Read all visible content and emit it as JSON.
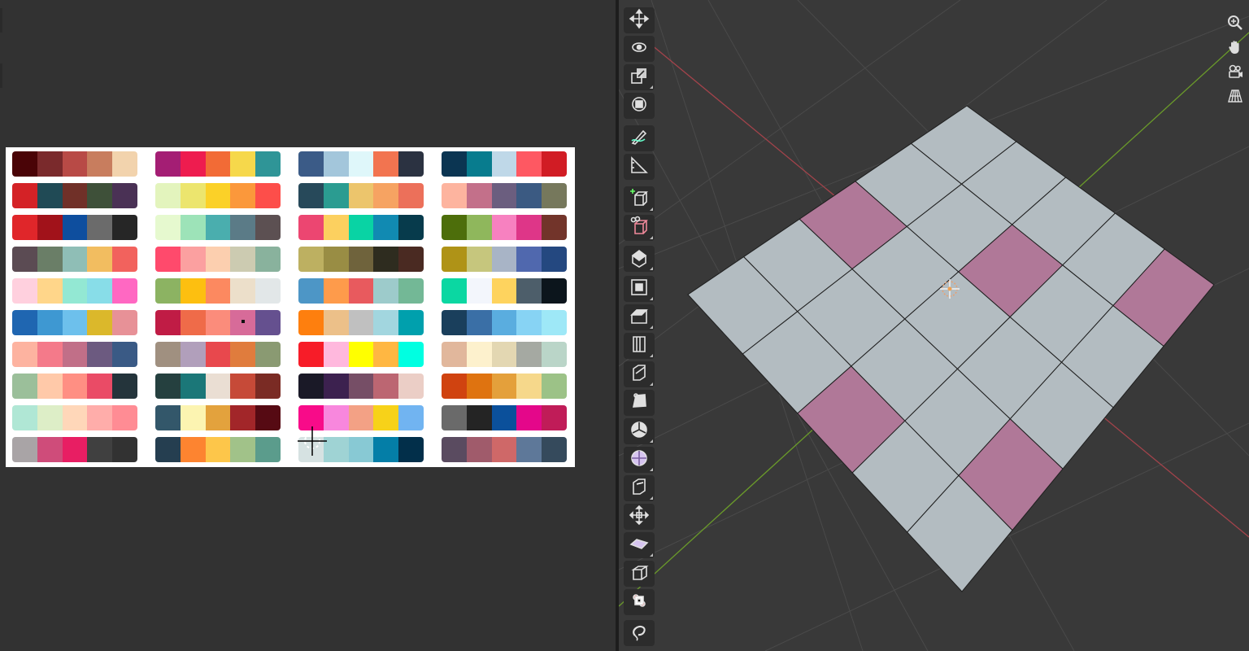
{
  "window": {
    "left_area": "image-editor",
    "right_area": "3d-viewport"
  },
  "colors": {
    "editor_bg": "#323232",
    "viewport_bg": "#393939",
    "toolbar_button": "#2c2c2c",
    "active_tool": "#4a6fa5",
    "plane_tile_gray": "#b3bcc1",
    "plane_tile_pink": "#b07898",
    "x_axis": "#a3434b",
    "y_axis": "#6a9a2a"
  },
  "palettes": [
    {
      "column": 1,
      "rows": [
        [
          "#4a0407",
          "#7a2a2c",
          "#b84a46",
          "#c87d5e",
          "#f2d3ad"
        ],
        [
          "#d42226",
          "#204a55",
          "#703028",
          "#3e5039",
          "#4a3155"
        ],
        [
          "#e0262a",
          "#a1121a",
          "#0e4e9e",
          "#6b6b6b",
          "#262626"
        ],
        [
          "#5b4b53",
          "#6a7e67",
          "#8fbeb6",
          "#f2bd60",
          "#f2625d"
        ],
        [
          "#ffd0de",
          "#ffd68a",
          "#93e8d3",
          "#88dde8",
          "#ff68c2"
        ],
        [
          "#1f66b1",
          "#3e98d2",
          "#6dc0ec",
          "#dbb82b",
          "#e79197"
        ],
        [
          "#fdb3a0",
          "#f47a8a",
          "#c16f88",
          "#6c5a80",
          "#3a5a85"
        ],
        [
          "#9bbf9a",
          "#ffc9a9",
          "#ff8f83",
          "#ea4b66",
          "#24343b"
        ],
        [
          "#b0e7d5",
          "#ddeec7",
          "#ffd7b9",
          "#ffadaa",
          "#ff8c94"
        ],
        [
          "#a9a4a6",
          "#cf4c7a",
          "#e81e63",
          "#404040",
          "#323232"
        ]
      ]
    },
    {
      "column": 2,
      "rows": [
        [
          "#a41e74",
          "#ee1c4f",
          "#f26b36",
          "#f6d84b",
          "#2f9597"
        ],
        [
          "#e3f4bd",
          "#ece56e",
          "#fbd128",
          "#fb983b",
          "#fd4e4a"
        ],
        [
          "#e6f9cf",
          "#9de3b8",
          "#4aaeae",
          "#5b7b87",
          "#5c5052"
        ],
        [
          "#ff4a6c",
          "#fba0a0",
          "#fccfaf",
          "#cccbb1",
          "#89b29d"
        ],
        [
          "#8cb362",
          "#fdbf10",
          "#fc8960",
          "#ecdfca",
          "#e2e7e8"
        ],
        [
          "#c01c45",
          "#ef6b49",
          "#fb8c7b",
          "#d76b99",
          "#65508f"
        ],
        [
          "#a09080",
          "#b19fbb",
          "#e8484d",
          "#e07c3d",
          "#8a9a72"
        ],
        [
          "#25403f",
          "#1b7778",
          "#eaded3",
          "#c64a38",
          "#7a2b24"
        ],
        [
          "#33576a",
          "#fcf4b1",
          "#e3a23d",
          "#a22629",
          "#560a13"
        ],
        [
          "#253e50",
          "#fd8430",
          "#fdc64a",
          "#a1c289",
          "#5b9c8c"
        ]
      ]
    },
    {
      "column": 3,
      "rows": [
        [
          "#3b5b87",
          "#a3c6db",
          "#dff7fa",
          "#f27450",
          "#2b3241"
        ],
        [
          "#27495a",
          "#2b9c91",
          "#ecc56c",
          "#f6a362",
          "#ec705a"
        ],
        [
          "#ec4671",
          "#fcd05f",
          "#09d3a4",
          "#118ab2",
          "#073b4c"
        ],
        [
          "#bdb061",
          "#998d44",
          "#6f633c",
          "#2e2c1f",
          "#4a2a22"
        ],
        [
          "#4d96c6",
          "#fe9b4b",
          "#e85a5e",
          "#9dcbcb",
          "#73b896"
        ],
        [
          "#fe7f0e",
          "#ecc089",
          "#c0c0c0",
          "#a2d6df",
          "#00a0ad"
        ],
        [
          "#f71c28",
          "#ffb8dd",
          "#ffff00",
          "#ffb742",
          "#00ffe1"
        ],
        [
          "#1a1927",
          "#3c214f",
          "#764e66",
          "#bc6672",
          "#ebcec6"
        ],
        [
          "#f80b89",
          "#f887dd",
          "#f3a185",
          "#f7d219",
          "#71b4f1"
        ],
        [
          "#d6e2e2",
          "#9fd3d4",
          "#88c9d4",
          "#047ea7",
          "#022f4a"
        ]
      ]
    },
    {
      "column": 4,
      "rows": [
        [
          "#0b3552",
          "#087c8e",
          "#bfd8e8",
          "#fe5862",
          "#d11c24"
        ],
        [
          "#fdb49f",
          "#c3708a",
          "#6b5e7f",
          "#3b5a82",
          "#76785c"
        ],
        [
          "#4d6e0b",
          "#8fb75c",
          "#f781c0",
          "#de3688",
          "#72342a"
        ],
        [
          "#af9317",
          "#c6c67d",
          "#a8b4c6",
          "#5068ae",
          "#244880"
        ],
        [
          "#0bd7a2",
          "#f3f6fc",
          "#fed35e",
          "#4d5e6a",
          "#0c151c"
        ],
        [
          "#1a3f5c",
          "#3a6fa6",
          "#5aaddf",
          "#87d3f4",
          "#9ee8f7"
        ],
        [
          "#e1b79c",
          "#fdf1cd",
          "#e3d7b2",
          "#a5a9a2",
          "#bad5c8"
        ],
        [
          "#d04310",
          "#df7310",
          "#e4a03b",
          "#f6d88b",
          "#9cc287"
        ],
        [
          "#6a6a6a",
          "#242424",
          "#0b509b",
          "#e4078a",
          "#c01c58"
        ],
        [
          "#5a4b60",
          "#a05b6b",
          "#cf6868",
          "#5e7899",
          "#354a5c"
        ]
      ]
    }
  ],
  "toolbar": {
    "tools": [
      {
        "name": "move-tool",
        "icon": "move-icon",
        "active": false
      },
      {
        "name": "rotate-tool",
        "icon": "rotate-icon",
        "active": false
      },
      {
        "name": "scale-tool",
        "icon": "scale-icon",
        "active": false
      },
      {
        "name": "transform-tool",
        "icon": "transform-icon",
        "active": false
      },
      {
        "name": "annotate-tool",
        "icon": "annotate-icon",
        "active": false
      },
      {
        "name": "measure-tool",
        "icon": "measure-icon",
        "active": false
      },
      {
        "name": "add-cube-tool",
        "icon": "add-cube-icon",
        "active": false
      },
      {
        "name": "knife-tool",
        "icon": "knife-icon",
        "active": false
      },
      {
        "name": "extrude-region-tool",
        "icon": "extrude-icon",
        "active": false
      },
      {
        "name": "inset-faces-tool",
        "icon": "inset-icon",
        "active": false
      },
      {
        "name": "bevel-tool",
        "icon": "bevel-icon",
        "active": false
      },
      {
        "name": "loop-cut-tool",
        "icon": "loop-cut-icon",
        "active": false
      },
      {
        "name": "knife-cut-tool",
        "icon": "knife-cut-icon",
        "active": false
      },
      {
        "name": "poly-build-tool",
        "icon": "poly-build-icon",
        "active": false
      },
      {
        "name": "spin-tool",
        "icon": "spin-icon",
        "active": false
      },
      {
        "name": "smooth-tool",
        "icon": "smooth-icon",
        "active": false
      },
      {
        "name": "edge-slide-tool",
        "icon": "edge-slide-icon",
        "active": false
      },
      {
        "name": "shrink-fatten-tool",
        "icon": "shrink-fatten-icon",
        "active": false
      },
      {
        "name": "shear-tool",
        "icon": "shear-icon",
        "active": false
      },
      {
        "name": "rip-region-tool",
        "icon": "rip-icon",
        "active": false
      },
      {
        "name": "uv-sync-tool",
        "icon": "uv-sync-icon",
        "active": false
      },
      {
        "name": "select-circle-tool",
        "icon": "lasso-icon",
        "active": false
      }
    ]
  },
  "navigation": {
    "buttons": [
      "zoom-icon",
      "pan-hand-icon",
      "camera-icon",
      "perspective-grid-icon"
    ]
  },
  "plane": {
    "grid": 5,
    "pink_cells": [
      [
        0,
        4
      ],
      [
        1,
        2
      ],
      [
        2,
        0
      ],
      [
        3,
        4
      ],
      [
        4,
        2
      ]
    ]
  }
}
